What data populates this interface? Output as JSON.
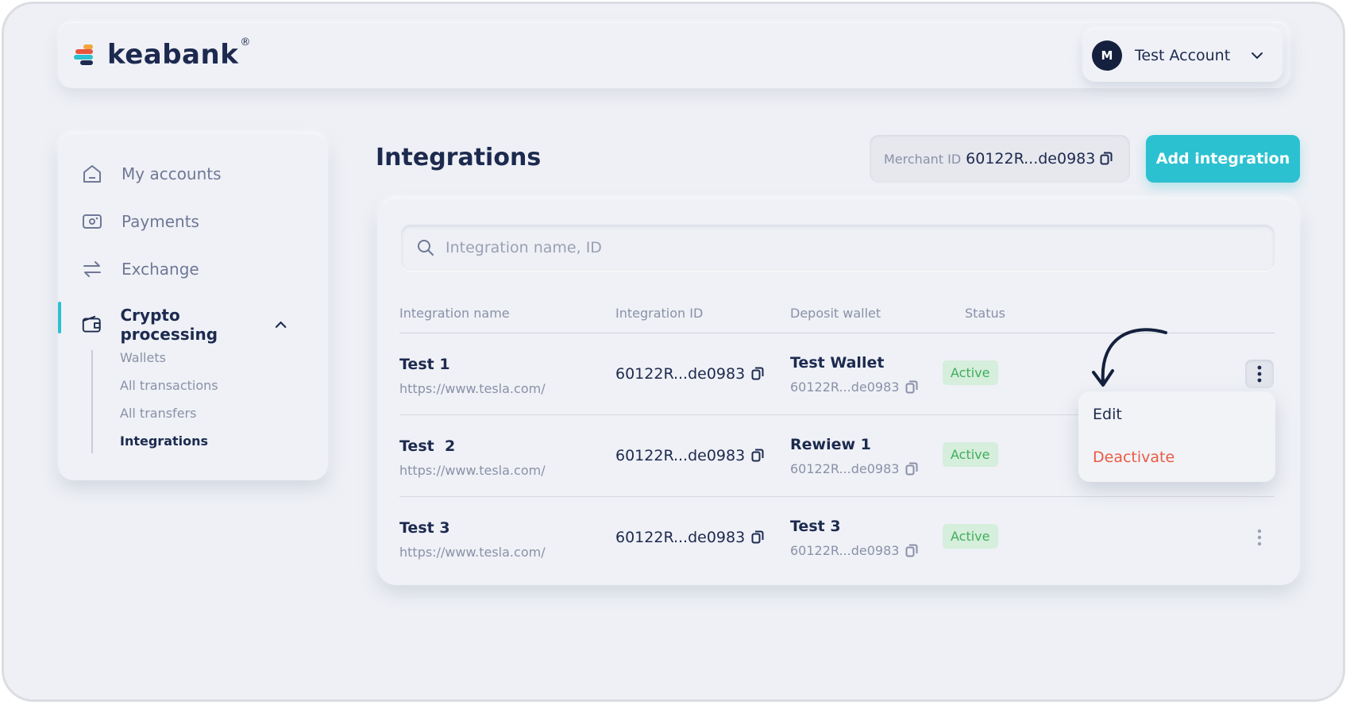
{
  "brand": {
    "name": "keabank",
    "reg": "®",
    "colors": {
      "accent": "#2bc1d0",
      "dark": "#1d2a4f",
      "active_text": "#3fae5c",
      "active_bg": "#d6eedc",
      "danger": "#e85b45"
    }
  },
  "account": {
    "initial": "M",
    "name": "Test Account"
  },
  "sidebar": {
    "items": [
      {
        "label": "My accounts",
        "icon": "home-icon"
      },
      {
        "label": "Payments",
        "icon": "payments-icon"
      },
      {
        "label": "Exchange",
        "icon": "exchange-icon"
      },
      {
        "label": "Crypto processing",
        "icon": "wallet-icon"
      }
    ],
    "subitems": [
      "Wallets",
      "All transactions",
      "All transfers",
      "Integrations"
    ]
  },
  "page": {
    "title": "Integrations",
    "merchant_label": "Merchant ID",
    "merchant_id": "60122R...de0983",
    "add_button": "Add integration"
  },
  "search": {
    "placeholder": "Integration name, ID"
  },
  "table": {
    "headers": [
      "Integration name",
      "Integration ID",
      "Deposit wallet",
      "Status"
    ],
    "rows": [
      {
        "name": "Test 1",
        "url": "https://www.tesla.com/",
        "id": "60122R...de0983",
        "wallet": "Test Wallet",
        "wallet_id": "60122R...de0983",
        "status": "Active"
      },
      {
        "name": "Test  2",
        "url": "https://www.tesla.com/",
        "id": "60122R...de0983",
        "wallet": "Rewiew 1",
        "wallet_id": "60122R...de0983",
        "status": "Active"
      },
      {
        "name": "Test 3",
        "url": "https://www.tesla.com/",
        "id": "60122R...de0983",
        "wallet": "Test 3",
        "wallet_id": "60122R...de0983",
        "status": "Active"
      }
    ]
  },
  "menu": {
    "edit": "Edit",
    "deactivate": "Deactivate"
  }
}
